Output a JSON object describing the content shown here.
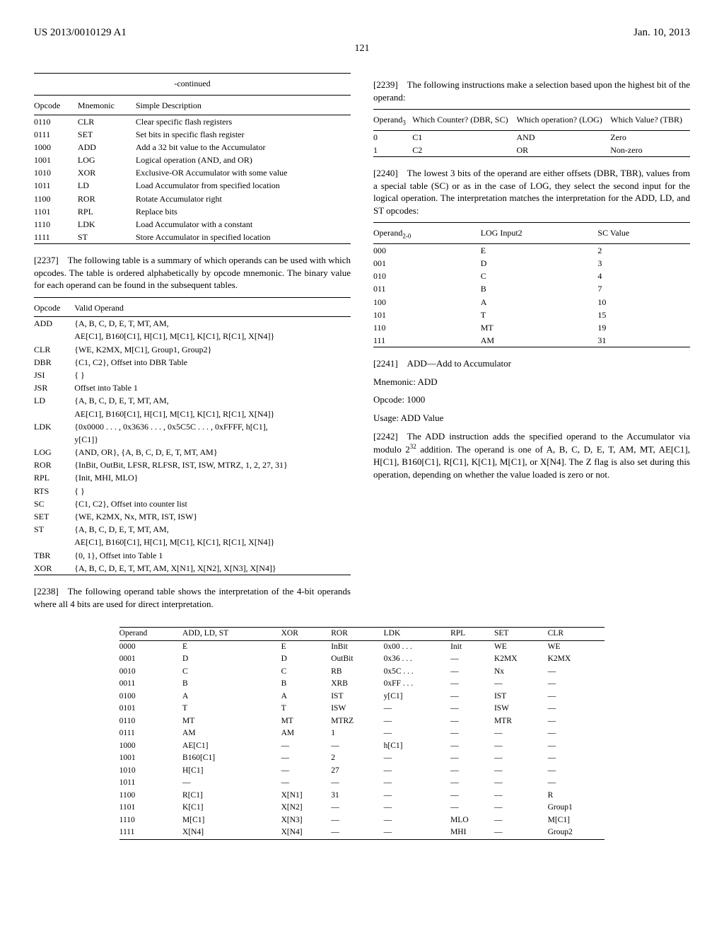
{
  "header": {
    "left": "US 2013/0010129 A1",
    "right": "Jan. 10, 2013"
  },
  "pageNumber": "121",
  "table1": {
    "caption": "-continued",
    "headers": [
      "Opcode",
      "Mnemonic",
      "Simple Description"
    ],
    "rows": [
      [
        "0110",
        "CLR",
        "Clear specific flash registers"
      ],
      [
        "0111",
        "SET",
        "Set bits in specific flash register"
      ],
      [
        "1000",
        "ADD",
        "Add a 32 bit value to the Accumulator"
      ],
      [
        "1001",
        "LOG",
        "Logical operation (AND, and OR)"
      ],
      [
        "1010",
        "XOR",
        "Exclusive-OR Accumulator with some value"
      ],
      [
        "1011",
        "LD",
        "Load Accumulator from specified location"
      ],
      [
        "1100",
        "ROR",
        "Rotate Accumulator right"
      ],
      [
        "1101",
        "RPL",
        "Replace bits"
      ],
      [
        "1110",
        "LDK",
        "Load Accumulator with a constant"
      ],
      [
        "1111",
        "ST",
        "Store Accumulator in specified location"
      ]
    ]
  },
  "para2237": "[2237] The following table is a summary of which operands can be used with which opcodes. The table is ordered alphabetically by opcode mnemonic. The binary value for each operand can be found in the subsequent tables.",
  "table2": {
    "headers": [
      "Opcode",
      "Valid Operand"
    ],
    "rows": [
      [
        "ADD",
        "{A, B, C, D, E, T, MT, AM,",
        "AE[C1], B160[C1], H[C1], M[C1], K[C1], R[C1], X[N4]}"
      ],
      [
        "CLR",
        "{WE, K2MX, M[C1], Group1, Group2}",
        ""
      ],
      [
        "DBR",
        "{C1, C2}, Offset into DBR Table",
        ""
      ],
      [
        "JSI",
        "{ }",
        ""
      ],
      [
        "JSR",
        "Offset into Table 1",
        ""
      ],
      [
        "LD",
        "{A, B, C, D, E, T, MT, AM,",
        "AE[C1], B160[C1], H[C1], M[C1], K[C1], R[C1], X[N4]}"
      ],
      [
        "LDK",
        "{0x0000 . . . , 0x3636 . . . , 0x5C5C . . . , 0xFFFF, h[C1],",
        "y[C1]}"
      ],
      [
        "LOG",
        "{AND, OR}, {A, B, C, D, E, T, MT, AM}",
        ""
      ],
      [
        "ROR",
        "{InBit, OutBit, LFSR, RLFSR, IST, ISW, MTRZ, 1, 2, 27, 31}",
        ""
      ],
      [
        "RPL",
        "{Init, MHI, MLO}",
        ""
      ],
      [
        "RTS",
        "{ }",
        ""
      ],
      [
        "SC",
        "{C1, C2}, Offset into counter list",
        ""
      ],
      [
        "SET",
        "{WE, K2MX, Nx, MTR, IST, ISW}",
        ""
      ],
      [
        "ST",
        "{A, B, C, D, E, T, MT, AM,",
        "AE[C1], B160[C1], H[C1], M[C1], K[C1], R[C1], X[N4]}"
      ],
      [
        "TBR",
        "{0, 1}, Offset into Table 1",
        ""
      ],
      [
        "XOR",
        "{A, B, C, D, E, T, MT, AM, X[N1], X[N2], X[N3], X[N4]}",
        ""
      ]
    ]
  },
  "para2238": "[2238] The following operand table shows the interpretation of the 4-bit operands where all 4 bits are used for direct interpretation.",
  "para2239": "[2239] The following instructions make a selection based upon the highest bit of the operand:",
  "table3": {
    "headers": [
      "Operand",
      "Which Counter? (DBR, SC)",
      "Which operation? (LOG)",
      "Which Value? (TBR)"
    ],
    "headerSub": "3",
    "rows": [
      [
        "0",
        "C1",
        "AND",
        "Zero"
      ],
      [
        "1",
        "C2",
        "OR",
        "Non-zero"
      ]
    ]
  },
  "para2240": "[2240] The lowest 3 bits of the operand are either offsets (DBR, TBR), values from a special table (SC) or as in the case of LOG, they select the second input for the logical operation. The interpretation matches the interpretation for the ADD, LD, and ST opcodes:",
  "table4": {
    "headers": [
      "Operand",
      "LOG Input2",
      "SC Value"
    ],
    "headerSub": "2-0",
    "rows": [
      [
        "000",
        "E",
        "2"
      ],
      [
        "001",
        "D",
        "3"
      ],
      [
        "010",
        "C",
        "4"
      ],
      [
        "011",
        "B",
        "7"
      ],
      [
        "100",
        "A",
        "10"
      ],
      [
        "101",
        "T",
        "15"
      ],
      [
        "110",
        "MT",
        "19"
      ],
      [
        "111",
        "AM",
        "31"
      ]
    ]
  },
  "para2241": "[2241] ADD—Add to Accumulator",
  "mnemonic": "Mnemonic: ADD",
  "opcode": "Opcode: 1000",
  "usage": "Usage: ADD Value",
  "para2242_a": "[2242] The ADD instruction adds the specified operand to the Accumulator via modulo 2",
  "para2242_sup": "32",
  "para2242_b": " addition. The operand is one of A, B, C, D, E, T, AM, MT, AE[C1], H[C1], B160[C1], R[C1], K[C1], M[C1], or X[N4]. The Z flag is also set during this operation, depending on whether the value loaded is zero or not.",
  "table5": {
    "headers": [
      "Operand",
      "ADD, LD, ST",
      "XOR",
      "ROR",
      "LDK",
      "RPL",
      "SET",
      "CLR"
    ],
    "rows": [
      [
        "0000",
        "E",
        "E",
        "InBit",
        "0x00 . . .",
        "Init",
        "WE",
        "WE"
      ],
      [
        "0001",
        "D",
        "D",
        "OutBit",
        "0x36 . . .",
        "—",
        "K2MX",
        "K2MX"
      ],
      [
        "0010",
        "C",
        "C",
        "RB",
        "0x5C . . .",
        "—",
        "Nx",
        "—"
      ],
      [
        "0011",
        "B",
        "B",
        "XRB",
        "0xFF . . .",
        "—",
        "—",
        "—"
      ],
      [
        "0100",
        "A",
        "A",
        "IST",
        "y[C1]",
        "—",
        "IST",
        "—"
      ],
      [
        "0101",
        "T",
        "T",
        "ISW",
        "—",
        "—",
        "ISW",
        "—"
      ],
      [
        "0110",
        "MT",
        "MT",
        "MTRZ",
        "—",
        "—",
        "MTR",
        "—"
      ],
      [
        "0111",
        "AM",
        "AM",
        "1",
        "—",
        "—",
        "—",
        "—"
      ],
      [
        "1000",
        "AE[C1]",
        "—",
        "—",
        "h[C1]",
        "—",
        "—",
        "—"
      ],
      [
        "1001",
        "B160[C1]",
        "—",
        "2",
        "—",
        "—",
        "—",
        "—"
      ],
      [
        "1010",
        "H[C1]",
        "—",
        "27",
        "—",
        "—",
        "—",
        "—"
      ],
      [
        "1011",
        "—",
        "—",
        "—",
        "—",
        "—",
        "—",
        "—"
      ],
      [
        "1100",
        "R[C1]",
        "X[N1]",
        "31",
        "—",
        "—",
        "—",
        "R"
      ],
      [
        "1101",
        "K[C1]",
        "X[N2]",
        "—",
        "—",
        "—",
        "—",
        "Group1"
      ],
      [
        "1110",
        "M[C1]",
        "X[N3]",
        "—",
        "—",
        "MLO",
        "—",
        "M[C1]"
      ],
      [
        "1111",
        "X[N4]",
        "X[N4]",
        "—",
        "—",
        "MHI",
        "—",
        "Group2"
      ]
    ]
  }
}
